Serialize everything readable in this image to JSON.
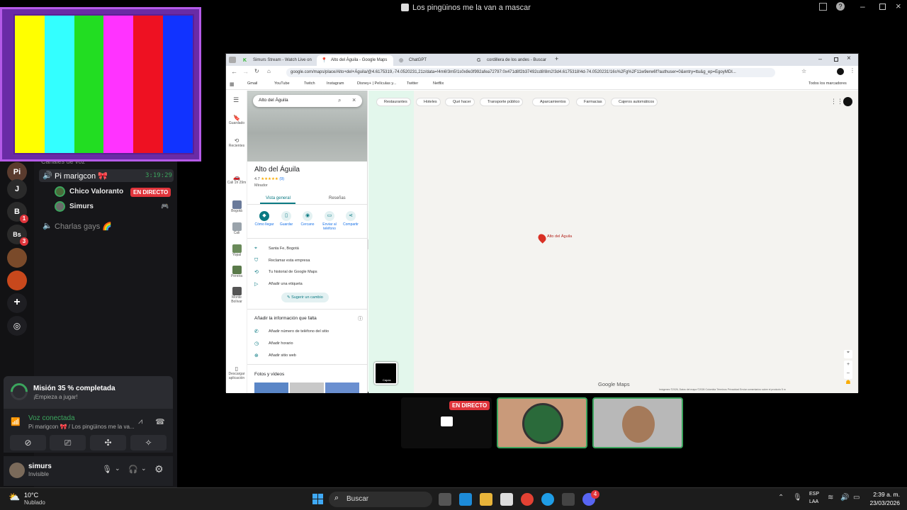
{
  "window": {
    "title": "Los pingüinos me la van a mascar"
  },
  "servers": [
    {
      "label": "Pi",
      "color": "#5a3b2e"
    },
    {
      "label": "J",
      "color": "#2a2a2a"
    },
    {
      "label": "B",
      "color": "#2a2a2a",
      "badge": "1"
    },
    {
      "label": "Bs",
      "color": "#2a2a2a",
      "badge": "3"
    },
    {
      "label": "",
      "color": "#7a4a2a"
    },
    {
      "label": "",
      "color": "#c8481c"
    }
  ],
  "channels": {
    "header": "Canales de voz",
    "main_channel": {
      "name": "Pi marigcon 🎀",
      "timer": "3:19:29"
    },
    "members": [
      {
        "name": "Chico Valoranto",
        "status": "EN DIRECTO"
      },
      {
        "name": "Simurs",
        "status": ""
      }
    ],
    "second_channel": {
      "name": "Charlas gays 🌈"
    }
  },
  "mission": {
    "title": "Misión 35 % completada",
    "subtitle": "¡Empieza a jugar!",
    "progress": 0.35
  },
  "voice": {
    "status": "Voz conectada",
    "location": "Pi marigcon 🎀 / Los pingüinos me la va..."
  },
  "user": {
    "name": "simurs",
    "status": "Invisible"
  },
  "color_bars": [
    "#ffff00",
    "#33ffff",
    "#22dd22",
    "#ff33ff",
    "#ee1122",
    "#1133ff"
  ],
  "browser": {
    "tabs": [
      {
        "label": "Simurs Stream - Watch Live on",
        "active": false
      },
      {
        "label": "Alto del Águila - Google Maps",
        "active": true
      },
      {
        "label": "ChatGPT",
        "active": false
      },
      {
        "label": "cordillera de los andes - Buscar",
        "active": false
      }
    ],
    "new_tab": "+",
    "url": "google.com/maps/place/Alto+del+Águila/@4.6175319,-74.0520231,21z/data=!4m6!3m5!1s0x8e3f992afea72797:0x471d8f2b37492cd8!8m2!3d4.6175318!4d-74.0520231!16s%2Fg%2F11w9erw6f?authuser=0&entry=ttu&g_ep=EgoyMDI...",
    "bookmarks": [
      "Gmail",
      "YouTube",
      "Twitch",
      "Instagram",
      "Disney+ | Películas y...",
      "Twitter",
      "Netflix"
    ],
    "all_bookmarks": "Todos los marcadores"
  },
  "maps": {
    "rail": [
      "Guardado",
      "Recientes",
      "Cali 1h 29m",
      "Bogotá",
      "Cali",
      "Yopal",
      "Pereira",
      "Monte Bolívar",
      "Descargar aplicación"
    ],
    "search_value": "Alto del Águila",
    "place": {
      "name": "Alto del Águila",
      "rating": "4.7",
      "stars": "★★★★★",
      "reviews": "(9)",
      "category": "Mirador"
    },
    "tabs": [
      "Vista general",
      "Reseñas"
    ],
    "actions": [
      "Cómo llegar",
      "Guardar",
      "Cercano",
      "Enviar al teléfono",
      "Compartir"
    ],
    "details": [
      "Santa Fe, Bogotá",
      "Reclamar esta empresa",
      "Tu historial de Google Maps",
      "Añadir una etiqueta"
    ],
    "suggest": "Sugerir un cambio",
    "missing_header": "Añadir la información que falta",
    "missing": [
      "Añadir número de teléfono del sitio",
      "Añadir horario",
      "Añadir sitio web"
    ],
    "photos": "Fotos y vídeos",
    "chips": [
      "Restaurantes",
      "Hoteles",
      "Qué hacer",
      "Transporte público",
      "Aparcamientos",
      "Farmacias",
      "Cajeros automáticos"
    ],
    "pin_label": "Alto del Águila",
    "watermark": "Google Maps",
    "layers": "Capas",
    "footer": "Imágenes ©2026, Datos del mapa ©2026   Colombia   Términos   Privacidad   Enviar comentarios sobre el producto   5 m"
  },
  "call": {
    "live_badge": "EN DIRECTO"
  },
  "taskbar": {
    "weather_temp": "10°C",
    "weather_desc": "Nublado",
    "search": "Buscar",
    "lang1": "ESP",
    "lang2": "LAA",
    "time": "2:39 a. m.",
    "date": "23/03/2026",
    "discord_badge": "4"
  }
}
